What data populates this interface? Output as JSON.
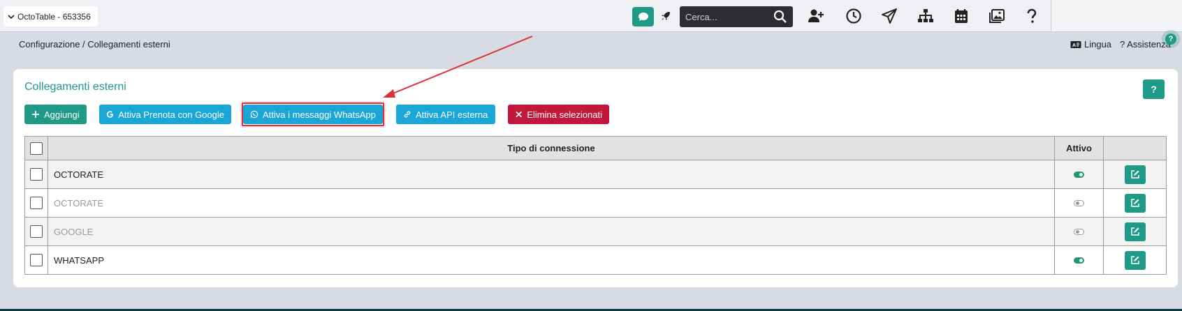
{
  "app": {
    "venue_label": "OctoTable - 653356"
  },
  "search": {
    "placeholder": "Cerca..."
  },
  "toolbar_icons": [
    "chat-icon",
    "rocket-icon",
    "add-user-icon",
    "clock-icon",
    "paper-plane-icon",
    "sitemap-icon",
    "calendar-icon",
    "images-icon",
    "question-icon"
  ],
  "header": {
    "breadcrumb": "Configurazione / Collegamenti esterni",
    "lingua": "Lingua",
    "assistenza": "? Assistenza",
    "help_bubble": "?"
  },
  "card": {
    "title": "Collegamenti esterni",
    "help": "?"
  },
  "buttons": {
    "aggiungi": "Aggiungi",
    "google": "Attiva Prenota con Google",
    "whatsapp": "Attiva i messaggi WhatsApp",
    "api": "Attiva API esterna",
    "elimina": "Elimina selezionati"
  },
  "table": {
    "headers": {
      "type": "Tipo di connessione",
      "active": "Attivo"
    },
    "rows": [
      {
        "type": "OCTORATE",
        "active": true
      },
      {
        "type": "OCTORATE",
        "active": false
      },
      {
        "type": "GOOGLE",
        "active": false
      },
      {
        "type": "WHATSAPP",
        "active": true
      }
    ]
  },
  "colors": {
    "brand_green": "#1f9a87",
    "cyan": "#1aa7d8",
    "red": "#c1183c",
    "annotation_red": "#d9333a"
  }
}
